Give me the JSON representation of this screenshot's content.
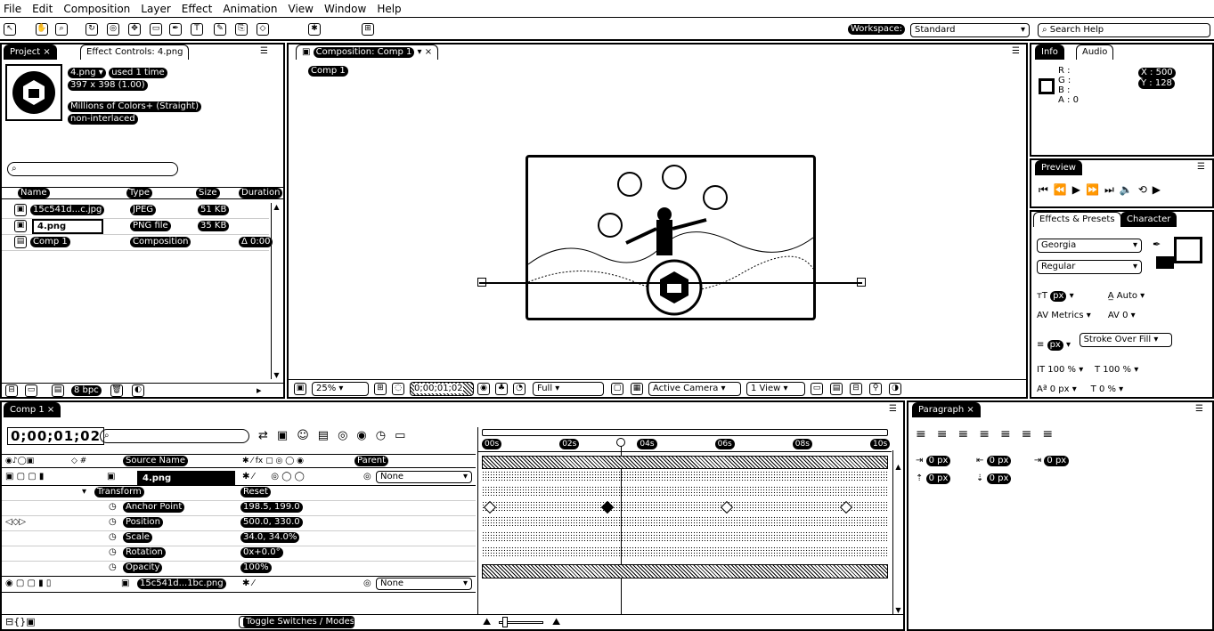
{
  "menu": [
    "File",
    "Edit",
    "Composition",
    "Layer",
    "Effect",
    "Animation",
    "View",
    "Window",
    "Help"
  ],
  "toolbar": {
    "workspace_label": "Workspace:",
    "workspace_value": "Standard",
    "search_placeholder": "Search Help"
  },
  "project_panel": {
    "tabs": [
      "Project ×",
      "Effect Controls: 4.png"
    ],
    "asset_name": "4.png ▾",
    "asset_used": "used 1 time",
    "asset_size": "397 x 398 (1.00)",
    "asset_colors": "Millions of Colors+ (Straight)",
    "asset_interlace": "non-interlaced",
    "columns": [
      "Name",
      "Type",
      "Size",
      "Duration"
    ],
    "items": [
      {
        "name": "15c541d...c.jpg",
        "type": "JPEG",
        "size": "51 KB",
        "icon": "image-icon"
      },
      {
        "name": "4.png",
        "type": "PNG file",
        "size": "35 KB",
        "icon": "image-icon"
      },
      {
        "name": "Comp 1",
        "type": "Composition",
        "size": "",
        "duration": "Δ 0:00",
        "icon": "composition-icon"
      }
    ],
    "bpc": "8 bpc"
  },
  "composition_panel": {
    "tab": "Composition: Comp 1",
    "breadcrumb": "Comp 1",
    "zoom": "25%",
    "timecode": "0;00;01;02",
    "resolution": "Full",
    "camera": "Active Camera",
    "views": "1 View"
  },
  "info_panel": {
    "tabs": [
      "Info",
      "Audio"
    ],
    "r_label": "R :",
    "g_label": "G :",
    "b_label": "B :",
    "a_label": "A : 0",
    "x_value": "X : 500",
    "y_value": "Y : 128"
  },
  "preview_panel": {
    "tab": "Preview"
  },
  "character_panel": {
    "tabs": [
      "Effects & Presets",
      "Character"
    ],
    "font": "Georgia",
    "style": "Regular",
    "size": "px",
    "leading": "Auto",
    "kerning": "Metrics",
    "tracking": "0",
    "stroke": "px",
    "stroke_type": "Stroke Over Fill",
    "vscale": "100 %",
    "hscale": "100 %",
    "baseline": "0 px",
    "tsume": "0 %"
  },
  "paragraph_panel": {
    "tab": "Paragraph",
    "indent_values": [
      "0 px",
      "0 px",
      "0 px",
      "0 px",
      "0 px"
    ]
  },
  "timeline": {
    "tab": "Comp 1",
    "timecode": "0;00;01;02",
    "ruler": [
      "00s",
      "02s",
      "04s",
      "06s",
      "08s",
      "10s"
    ],
    "layer_columns": [
      "Source Name",
      "Parent"
    ],
    "layers": [
      {
        "name": "4.png",
        "parent": "None"
      },
      {
        "name": "15c541d...1bc.png",
        "parent": "None"
      }
    ],
    "properties": [
      {
        "name": "Transform",
        "value": "Reset"
      },
      {
        "name": "Anchor Point",
        "value": "198.5, 199.0"
      },
      {
        "name": "Position",
        "value": "500.0, 330.0"
      },
      {
        "name": "Scale",
        "value": "34.0, 34.0%"
      },
      {
        "name": "Rotation",
        "value": "0x+0.0°"
      },
      {
        "name": "Opacity",
        "value": "100%"
      }
    ],
    "toggle_label": "Toggle Switches / Modes"
  }
}
